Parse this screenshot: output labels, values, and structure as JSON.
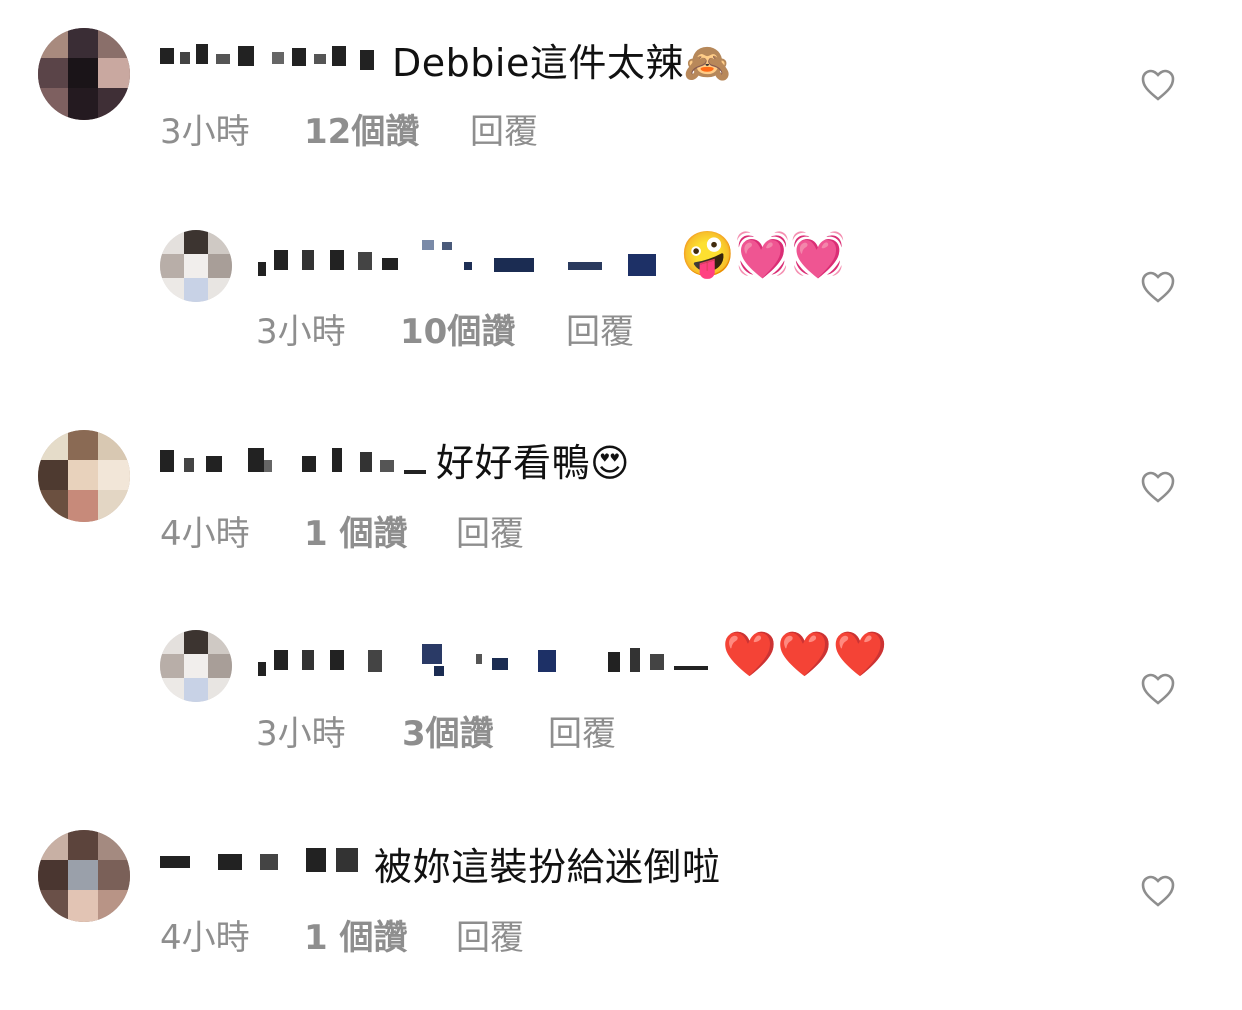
{
  "comments": [
    {
      "text": "Debbie這件太辣🙈",
      "time": "3小時",
      "likes": "12個讚",
      "reply": "回覆",
      "is_reply": false
    },
    {
      "text": "🤪💓💓",
      "time": "3小時",
      "likes": "10個讚",
      "reply": "回覆",
      "is_reply": true
    },
    {
      "text": "好好看鴨😍",
      "time": "4小時",
      "likes": "1 個讚",
      "reply": "回覆",
      "is_reply": false
    },
    {
      "text": "❤️❤️❤️",
      "time": "3小時",
      "likes": "3個讚",
      "reply": "回覆",
      "is_reply": true
    },
    {
      "text": "被妳這裝扮給迷倒啦",
      "time": "4小時",
      "likes": "1 個讚",
      "reply": "回覆",
      "is_reply": false
    }
  ],
  "icons": {
    "like": "heart-outline-icon"
  },
  "colors": {
    "text": "#111111",
    "meta": "#8e8e8e",
    "heart_outline": "#8e8e8e"
  }
}
